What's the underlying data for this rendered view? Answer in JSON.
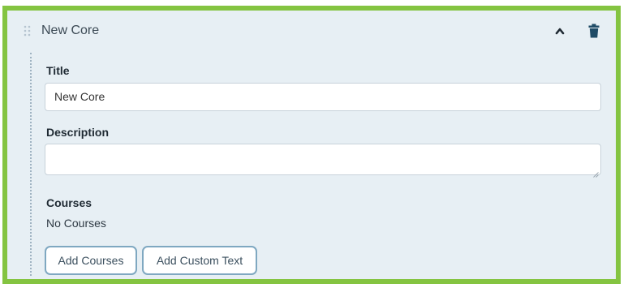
{
  "section": {
    "name": "New Core"
  },
  "icons": {
    "drag": "drag-handle-icon",
    "collapse": "chevron-up-icon",
    "delete": "trash-icon"
  },
  "form": {
    "title_label": "Title",
    "title_value": "New Core",
    "description_label": "Description",
    "description_value": "",
    "courses_label": "Courses",
    "courses_value": "No Courses"
  },
  "buttons": {
    "add_courses": "Add Courses",
    "add_custom_text": "Add Custom Text"
  },
  "colors": {
    "highlight_border": "#84c441",
    "panel_bg": "#e7eff4",
    "button_border": "#7fa8c1",
    "trash": "#1f4b66"
  }
}
